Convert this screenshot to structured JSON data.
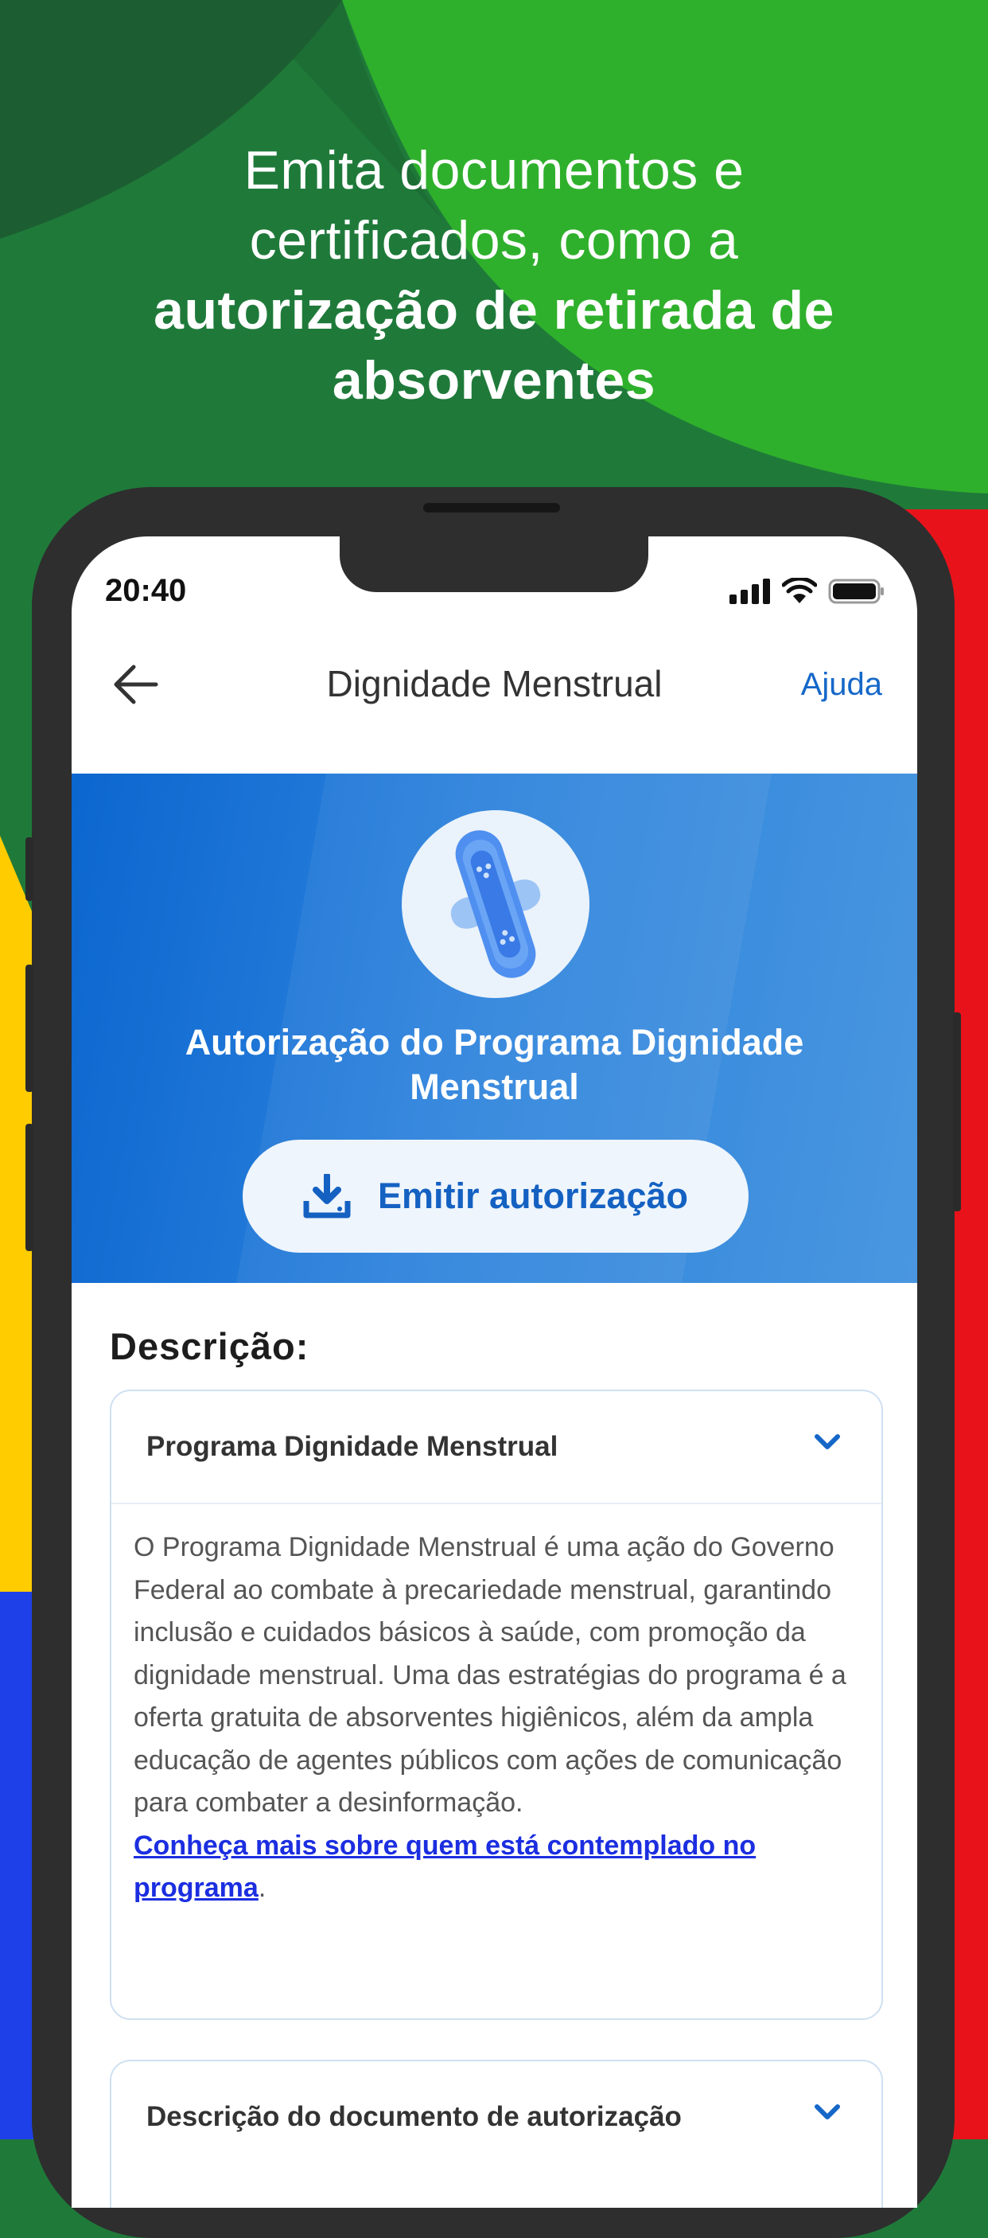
{
  "promo": {
    "headline_line1": "Emita documentos e",
    "headline_line2": "certificados, como a",
    "headline_bold1": "autorização de retirada de",
    "headline_bold2": "absorventes"
  },
  "status_bar": {
    "time": "20:40"
  },
  "app_bar": {
    "title": "Dignidade Menstrual",
    "help_label": "Ajuda"
  },
  "hero": {
    "title_line1": "Autorização do Programa Dignidade",
    "title_line2": "Menstrual",
    "emit_button_label": "Emitir autorização"
  },
  "description": {
    "heading": "Descrição:",
    "cards": [
      {
        "title": "Programa Dignidade Menstrual",
        "body": "O Programa Dignidade Menstrual é uma ação do Governo Federal ao combate à precariedade menstrual, garantindo inclusão e cuidados básicos à saúde, com promoção da dignidade menstrual. Uma das estratégias do programa é a oferta gratuita de absorventes higiênicos, além da ampla educação de agentes públicos com ações de comunicação para combater a desinformação.",
        "link": "Conheça mais sobre quem está contemplado no programa",
        "link_suffix": "."
      },
      {
        "title": "Descrição do documento de autorização"
      }
    ]
  },
  "colors": {
    "accent": "#1567c8",
    "hero_blue": "#0b66cf",
    "link": "#1b2ee0",
    "bg_green": "#1f7a3a"
  }
}
